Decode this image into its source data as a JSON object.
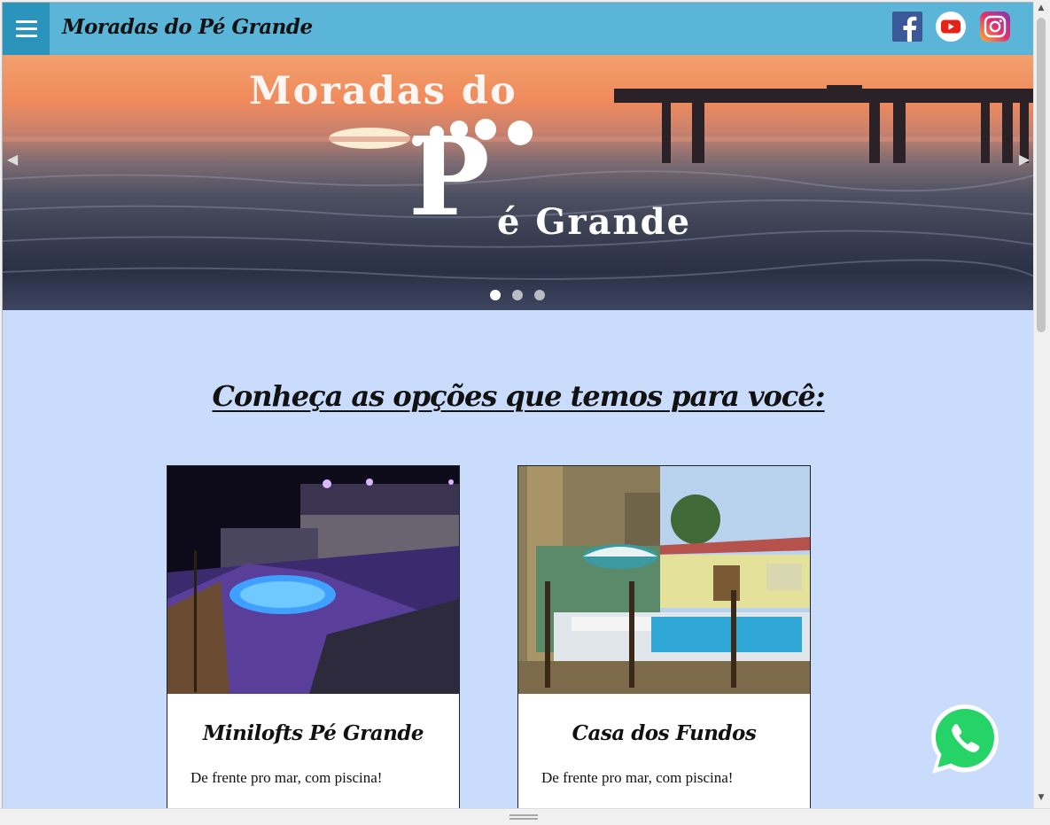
{
  "header": {
    "site_title": "Moradas do Pé Grande",
    "menu_icon": "hamburger-menu-icon",
    "social": [
      {
        "name": "facebook",
        "icon": "facebook-icon",
        "color": "#3b5998"
      },
      {
        "name": "youtube",
        "icon": "youtube-icon",
        "color": "#ff0000"
      },
      {
        "name": "instagram",
        "icon": "instagram-icon",
        "color": "#e1306c"
      }
    ],
    "bar_color": "#5ab5d9",
    "menu_color": "#2b94bd"
  },
  "hero": {
    "logo_line1": "Moradas do",
    "logo_big_letter": "P",
    "logo_line2": "é Grande",
    "slides_total": 3,
    "active_slide": 1
  },
  "section": {
    "heading": "Conheça as opções que temos para você:"
  },
  "cards": [
    {
      "title": "Minilofts Pé Grande",
      "description": "De frente pro mar, com piscina!"
    },
    {
      "title": "Casa dos Fundos",
      "description": "De frente pro mar, com piscina!"
    }
  ],
  "floating": {
    "icon": "whatsapp-icon",
    "color": "#25d366"
  },
  "colors": {
    "page_bg": "#c9dcfb"
  }
}
